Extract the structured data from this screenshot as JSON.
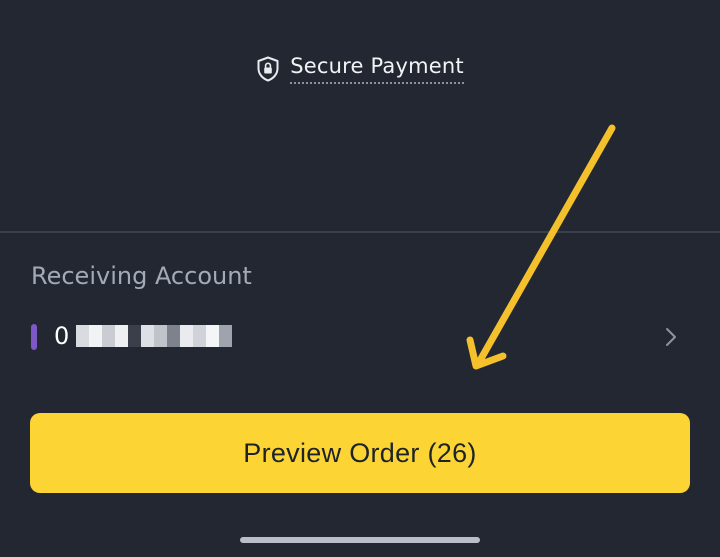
{
  "secure": {
    "label": "Secure Payment",
    "icon": "shield-lock-icon"
  },
  "receiving": {
    "section_label": "Receiving Account",
    "account_number_visible": "0",
    "account_masked": true,
    "accent_color": "#7f58c7"
  },
  "preview": {
    "button_label": "Preview Order (26)"
  },
  "colors": {
    "background": "#222731",
    "button": "#fcd535",
    "annotation_arrow": "#f4c02b"
  }
}
